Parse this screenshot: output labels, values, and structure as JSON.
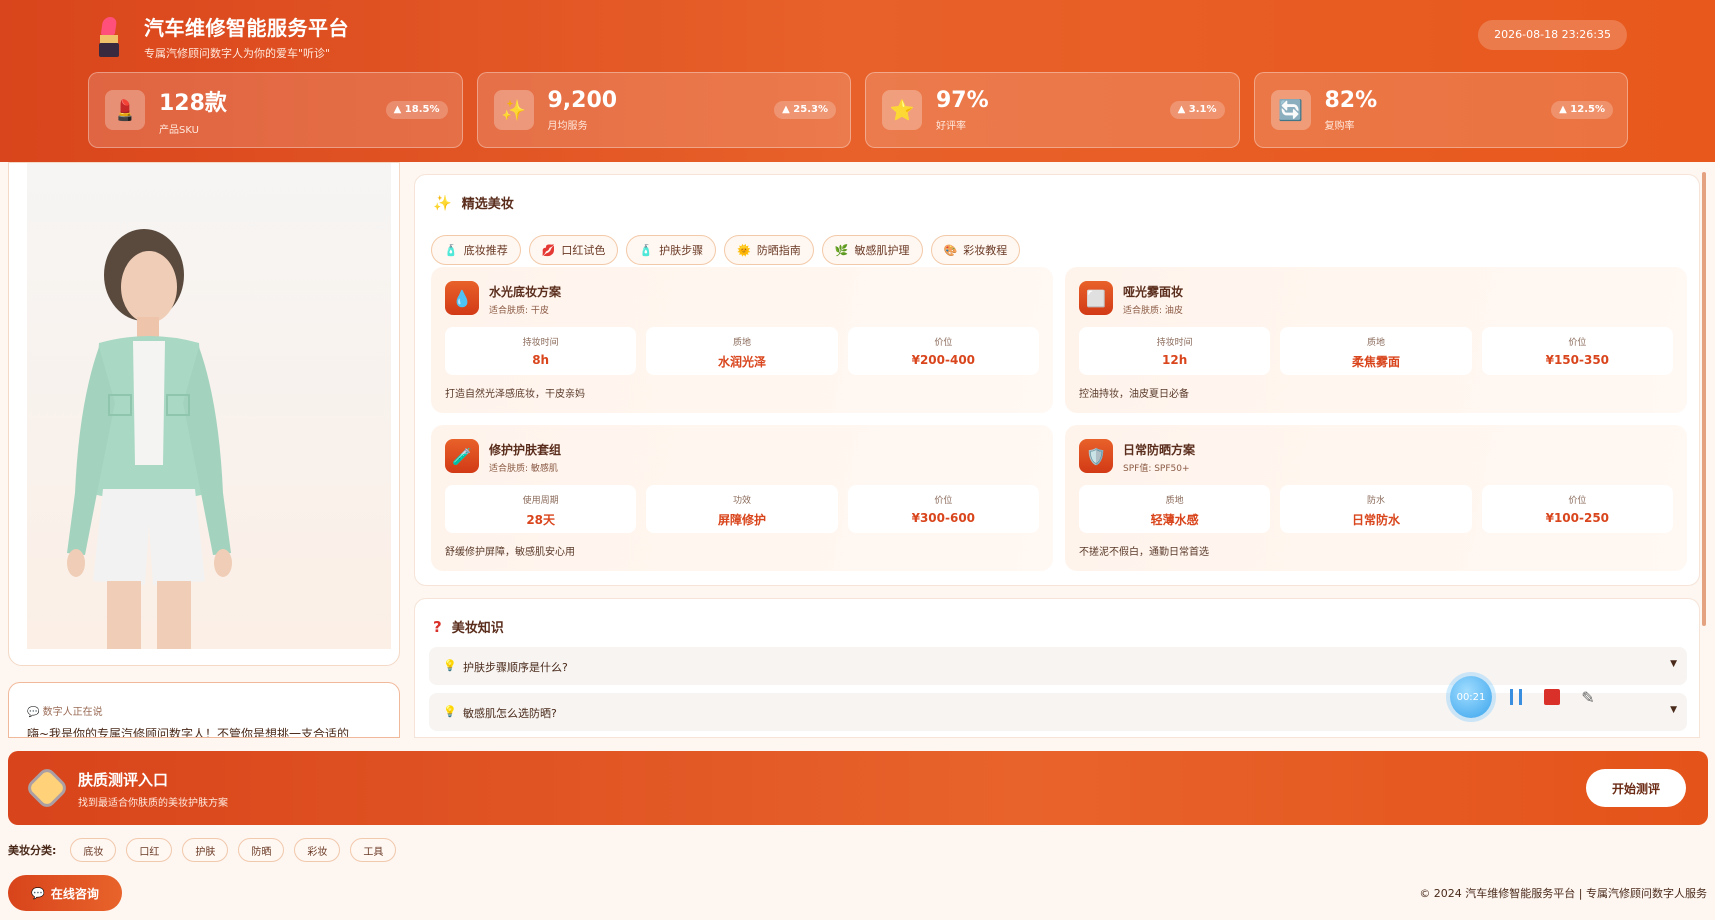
{
  "header": {
    "title": "汽车维修智能服务平台",
    "subtitle": "专属汽修顾问数字人为你的爱车\"听诊\"",
    "datetime": "2026-08-18 23:26:35"
  },
  "stats": [
    {
      "icon": "💄",
      "icon_name": "lipstick-icon",
      "value": "128款",
      "label": "产品SKU",
      "badge": "▲ 18.5%"
    },
    {
      "icon": "✨",
      "icon_name": "sparkles-icon",
      "value": "9,200",
      "label": "月均服务",
      "badge": "▲ 25.3%"
    },
    {
      "icon": "⭐",
      "icon_name": "star-icon",
      "value": "97%",
      "label": "好评率",
      "badge": "▲ 3.1%"
    },
    {
      "icon": "🔄",
      "icon_name": "repeat-icon",
      "value": "82%",
      "label": "复购率",
      "badge": "▲ 12.5%"
    }
  ],
  "speech": {
    "tag": "💬 数字人正在说",
    "text": "嗨~我是你的专属汽修顾问数字人！不管你是想挑一支合适的"
  },
  "featured": {
    "title": "精选美妆",
    "chips": [
      {
        "icon": "🧴",
        "label": "底妆推荐"
      },
      {
        "icon": "💋",
        "label": "口红试色"
      },
      {
        "icon": "🧴",
        "label": "护肤步骤"
      },
      {
        "icon": "🌞",
        "label": "防晒指南"
      },
      {
        "icon": "🌿",
        "label": "敏感肌护理"
      },
      {
        "icon": "🎨",
        "label": "彩妆教程"
      }
    ],
    "products": [
      {
        "icon": "💧",
        "name": "水光底妆方案",
        "sub": "适合肤质: 干皮",
        "metrics": [
          {
            "label": "持妆时间",
            "value": "8h"
          },
          {
            "label": "质地",
            "value": "水润光泽"
          },
          {
            "label": "价位",
            "value": "¥200-400"
          }
        ],
        "desc": "打造自然光泽感底妆，干皮亲妈"
      },
      {
        "icon": "⬜",
        "name": "哑光雾面妆",
        "sub": "适合肤质: 油皮",
        "metrics": [
          {
            "label": "持妆时间",
            "value": "12h"
          },
          {
            "label": "质地",
            "value": "柔焦雾面"
          },
          {
            "label": "价位",
            "value": "¥150-350"
          }
        ],
        "desc": "控油持妆，油皮夏日必备"
      },
      {
        "icon": "🧪",
        "name": "修护护肤套组",
        "sub": "适合肤质: 敏感肌",
        "metrics": [
          {
            "label": "使用周期",
            "value": "28天"
          },
          {
            "label": "功效",
            "value": "屏障修护"
          },
          {
            "label": "价位",
            "value": "¥300-600"
          }
        ],
        "desc": "舒缓修护屏障，敏感肌安心用"
      },
      {
        "icon": "🛡️",
        "name": "日常防晒方案",
        "sub": "SPF值: SPF50+",
        "metrics": [
          {
            "label": "质地",
            "value": "轻薄水感"
          },
          {
            "label": "防水",
            "value": "日常防水"
          },
          {
            "label": "价位",
            "value": "¥100-250"
          }
        ],
        "desc": "不搓泥不假白，通勤日常首选"
      }
    ]
  },
  "knowledge": {
    "title": "美妆知识",
    "faqs": [
      {
        "q": "护肤步骤顺序是什么?"
      },
      {
        "q": "敏感肌怎么选防晒?"
      }
    ]
  },
  "recorder": {
    "timer": "00:21"
  },
  "banner": {
    "title": "肤质测评入口",
    "subtitle": "找到最适合你肤质的美妆护肤方案",
    "button": "开始测评"
  },
  "categories": {
    "label": "美妆分类:",
    "items": [
      "底妆",
      "口红",
      "护肤",
      "防晒",
      "彩妆",
      "工具"
    ]
  },
  "consult": {
    "label": "在线咨询"
  },
  "footer": {
    "text": "© 2024 汽车维修智能服务平台 | 专属汽修顾问数字人服务"
  },
  "colors": {
    "primary": "#d9451c",
    "accent": "#e8612a",
    "background": "#fdf6f1"
  }
}
